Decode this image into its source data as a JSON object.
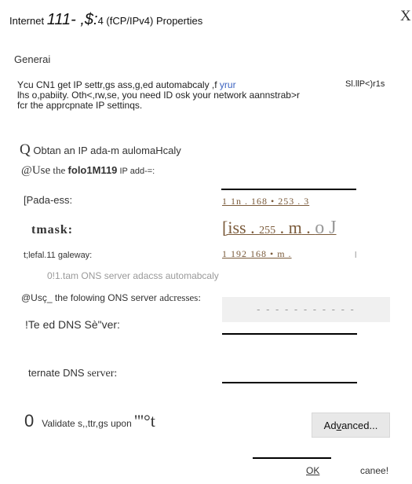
{
  "window": {
    "title_prefix": "Internet ",
    "title_big": "111- ,$:",
    "title_suffix": "4 (fCP/IPv4) Properties",
    "close": "X"
  },
  "tab": {
    "label": "Generai"
  },
  "description": {
    "line1_a": "Ycu CN1 get IP settr,gs ass,g,ed automabcaly ,f ",
    "line1_link": "yrur",
    "line1_b": "Sl.llP<)r1s",
    "line2": "lhs o,pabiity. Oth<,rw,se, you need ID osk your network aannstrab>r",
    "line3": "fcr the apprcpnate IP settinqs."
  },
  "ip_section": {
    "auto_q": "Q",
    "auto_label": " Obtan an IP ada-m aulomaHcaly",
    "manual_prefix": "@Use",
    "manual_mid": " the ",
    "manual_bold": "folo1M119",
    "manual_suffix": " IP add-=:",
    "address_label": "[Pada-ess:",
    "address_value": "1 1n . 168 • 253 . 3",
    "subnet_label": "tmask:",
    "subnet_part1": "[iss",
    "subnet_dot1": " . ",
    "subnet_part2": "255",
    "subnet_dot2": " . ",
    "subnet_part3": "m",
    "subnet_dot3": " . ",
    "subnet_part4": "o J",
    "gateway_label": "t;lefal.11 galeway:",
    "gateway_value": "1 192 168 • m .",
    "gateway_end": "l"
  },
  "dns_section": {
    "auto_label": "0!1.tam ONS server adacss automabcaly",
    "manual_label_a": "@Usç_ the folowing ONS server ",
    "manual_label_b": "adcresses:",
    "dns_placeholder": "- - - - - - - - - - -",
    "preferred_label": "!Te ed DNS Sè\"ver:",
    "alternate_label_a": "ternate DNS ",
    "alternate_label_b": "server:"
  },
  "footer": {
    "validate_zero": "0",
    "validate_label": "Validate s,,ttr,gs upon ",
    "validate_tail": "'''°t",
    "advanced_a": "Ad",
    "advanced_u": "v",
    "advanced_b": "anced...",
    "ok": "OK",
    "cancel": "canee!"
  }
}
